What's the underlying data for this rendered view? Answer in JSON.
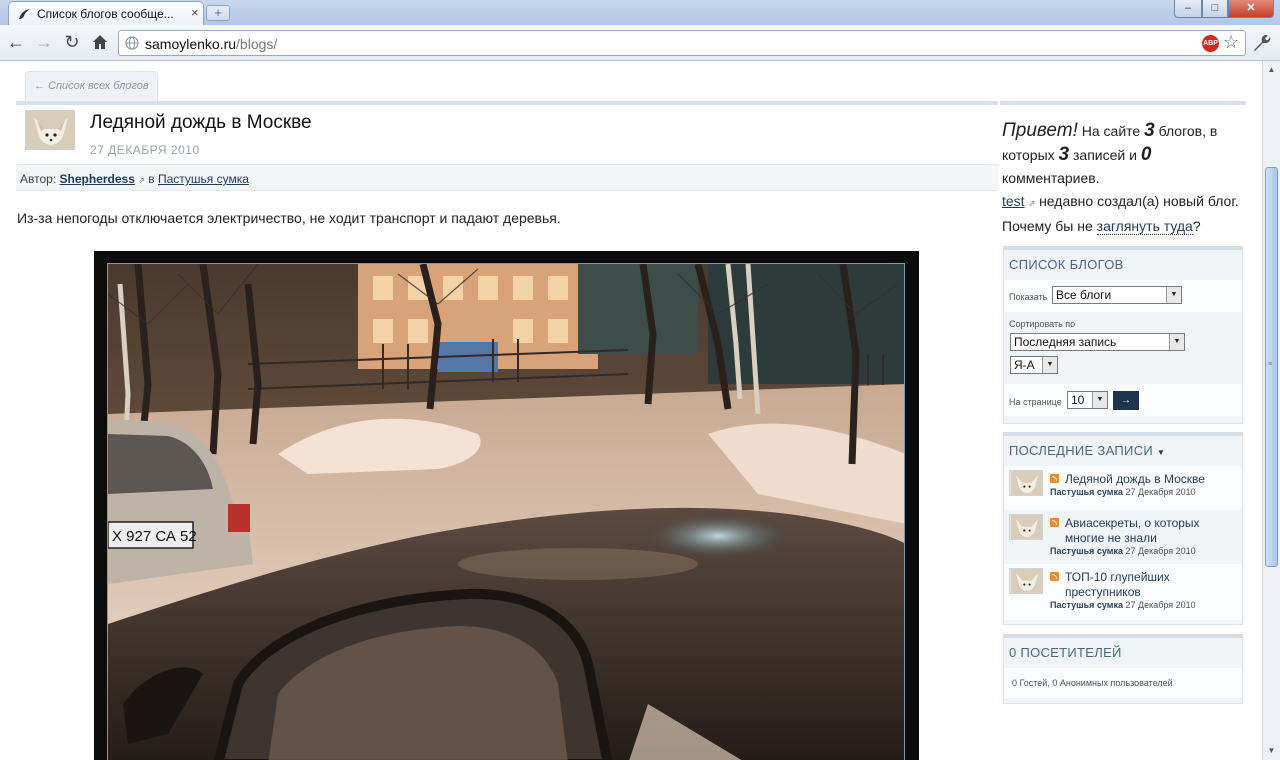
{
  "browser": {
    "tab_title": "Список блогов сообще...",
    "url_host": "samoylenko.ru",
    "url_path": "/blogs/",
    "adblock_label": "ABP"
  },
  "page": {
    "back_link": "← Список всех блогов",
    "post": {
      "title": "Ледяной дождь в Москве",
      "date": "27 ДЕКАБРЯ 2010",
      "author_label": "Автор:",
      "author": "Shepherdess",
      "in_label": "в",
      "blog": "Пастушья сумка",
      "text": "Из-за непогоды отключается электричество, не ходит транспорт и падают деревья.",
      "photo_plate": "Х 927 СА 52"
    }
  },
  "sidebar": {
    "greeting": {
      "hello": "Привет!",
      "t1": "На сайте",
      "blogs_count": "3",
      "t2": "блогов, в которых",
      "posts_count": "3",
      "t3": "записей и",
      "comments_count": "0",
      "t4": "комментариев.",
      "new_user": "test",
      "t5": "недавно создал(а) новый блог. Почему бы не",
      "look_link": "заглянуть туда",
      "t6": "?"
    },
    "blog_list": {
      "title": "СПИСОК БЛОГОВ",
      "show_label": "Показать",
      "show_value": "Все блоги",
      "sort_label": "Сортировать по",
      "sort_value": "Последняя запись",
      "order_value": "Я-А",
      "per_page_label": "На странице",
      "per_page_value": "10",
      "go_label": "→"
    },
    "recent": {
      "title": "ПОСЛЕДНИЕ ЗАПИСИ",
      "items": [
        {
          "title": "Ледяной дождь в Москве",
          "blog": "Пастушья сумка",
          "date": "27 Декабря 2010"
        },
        {
          "title": "Авиасекреты, о которых многие не знали",
          "blog": "Пастушья сумка",
          "date": "27 Декабря 2010"
        },
        {
          "title": "ТОП-10 глупейших преступников",
          "blog": "Пастушья сумка",
          "date": "27 Декабря 2010"
        }
      ]
    },
    "visitors": {
      "title": "0 ПОСЕТИТЕЛЕЙ",
      "text": "0 Гостей, 0 Анонимных пользователей"
    }
  },
  "colors": {
    "link": "#1f3a5f",
    "box_header": "#4a6787",
    "go_button": "#1e3550"
  }
}
